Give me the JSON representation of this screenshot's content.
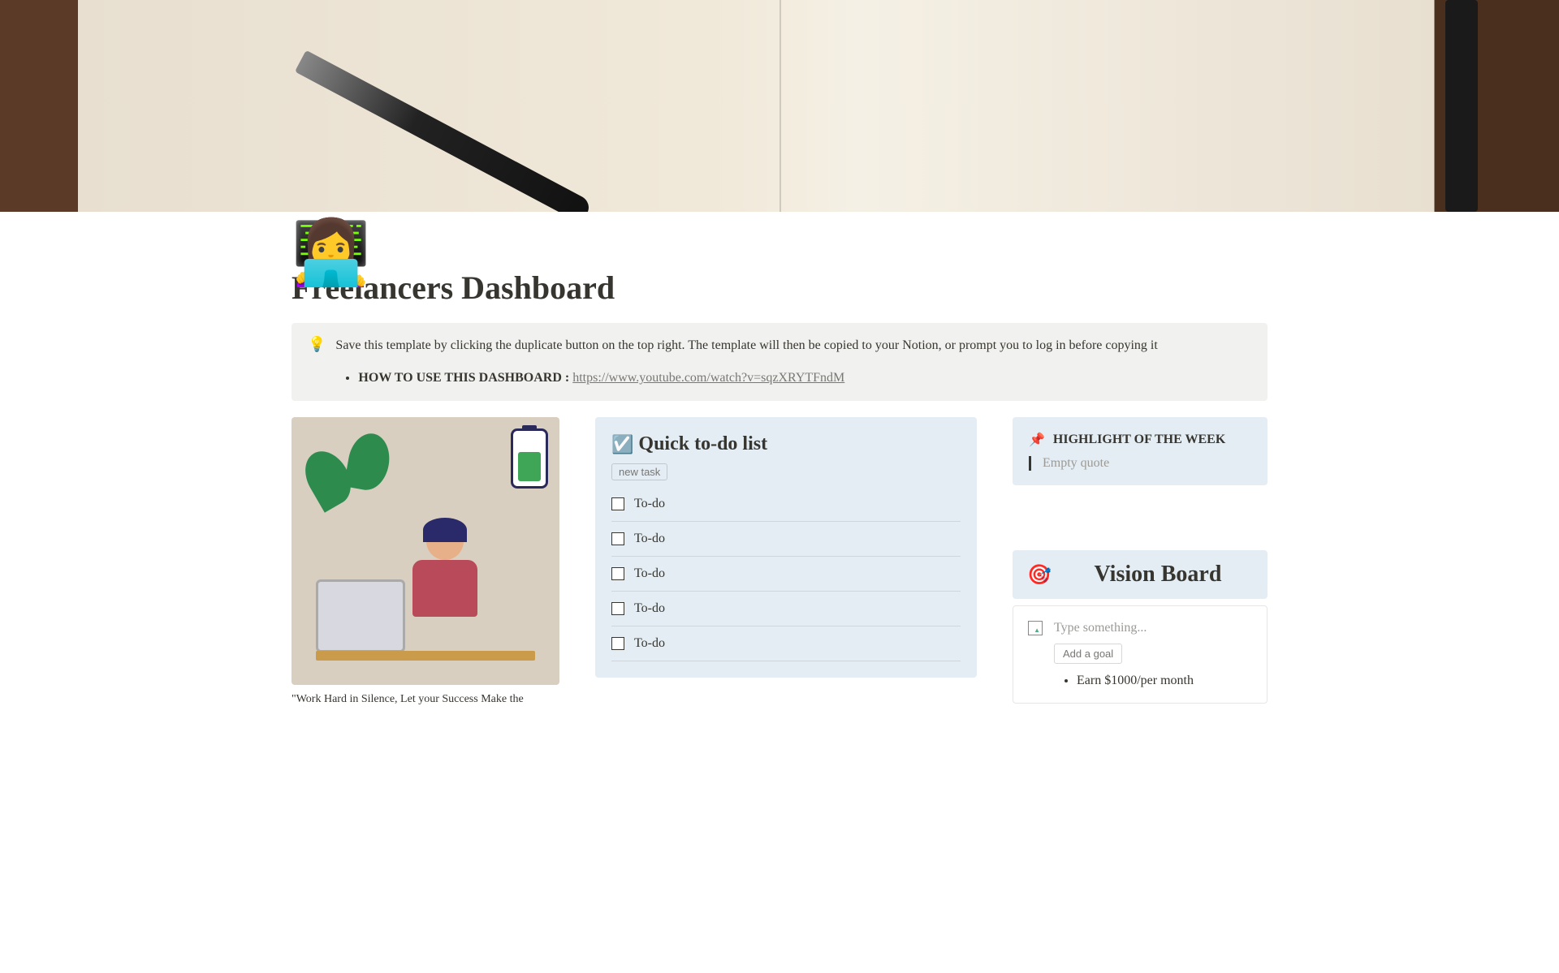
{
  "page": {
    "icon": "👩‍💻",
    "title": "Freelancers Dashboard"
  },
  "callout": {
    "icon": "💡",
    "text": "Save this template by clicking the duplicate button on the top right. The template will then be copied to your Notion, or prompt you to log in before copying it",
    "howto_label": "HOW TO USE THIS DASHBOARD :",
    "howto_link": "https://www.youtube.com/watch?v=sqzXRYTFndM"
  },
  "illustration": {
    "caption": "\"Work Hard in Silence, Let your Success Make the"
  },
  "todo": {
    "icon": "☑️",
    "heading": "Quick to-do list",
    "new_task_label": "new task",
    "items": [
      "To-do",
      "To-do",
      "To-do",
      "To-do",
      "To-do"
    ]
  },
  "highlight": {
    "icon": "📌",
    "title": "HIGHLIGHT OF THE WEEK",
    "quote_placeholder": "Empty quote"
  },
  "vision": {
    "icon": "🎯",
    "heading": "Vision Board",
    "placeholder": "Type something...",
    "add_goal_label": "Add a goal",
    "goals": [
      "Earn $1000/per month"
    ]
  }
}
